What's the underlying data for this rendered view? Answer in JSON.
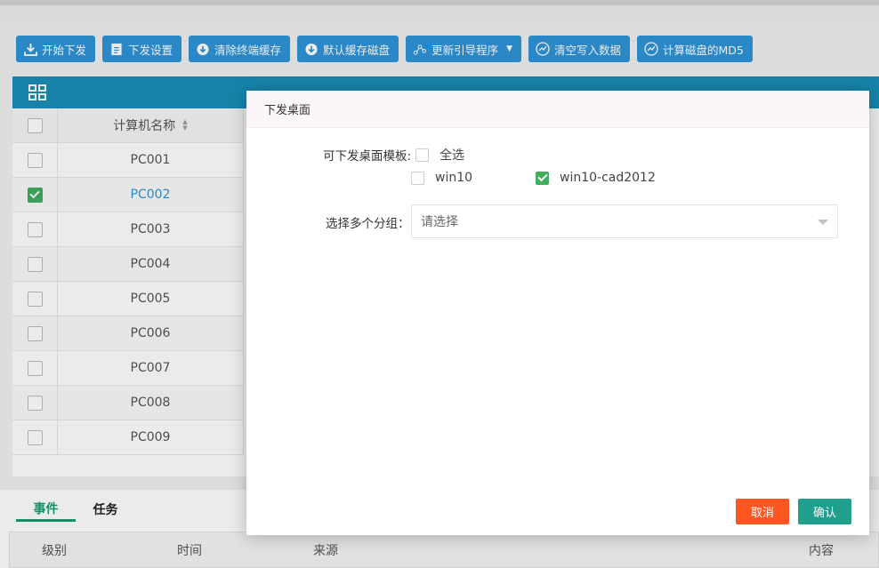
{
  "toolbar": {
    "buttons": [
      {
        "label": "开始下发",
        "icon": "download-icon"
      },
      {
        "label": "下发设置",
        "icon": "file-icon"
      },
      {
        "label": "清除终端缓存",
        "icon": "cloud-download-icon"
      },
      {
        "label": "默认缓存磁盘",
        "icon": "cloud-download-icon"
      },
      {
        "label": "更新引导程序",
        "icon": "network-icon",
        "dropdown": true
      },
      {
        "label": "清空写入数据",
        "icon": "chart-icon"
      },
      {
        "label": "计算磁盘的MD5",
        "icon": "chart-icon"
      }
    ]
  },
  "table": {
    "column_name": "计算机名称",
    "rows": [
      {
        "name": "PC001",
        "checked": false
      },
      {
        "name": "PC002",
        "checked": true
      },
      {
        "name": "PC003",
        "checked": false
      },
      {
        "name": "PC004",
        "checked": false
      },
      {
        "name": "PC005",
        "checked": false
      },
      {
        "name": "PC006",
        "checked": false
      },
      {
        "name": "PC007",
        "checked": false
      },
      {
        "name": "PC008",
        "checked": false
      },
      {
        "name": "PC009",
        "checked": false
      }
    ]
  },
  "bottom": {
    "tabs": [
      {
        "label": "事件",
        "active": true
      },
      {
        "label": "任务",
        "active": false
      }
    ],
    "columns": [
      "级别",
      "时间",
      "来源",
      "内容"
    ]
  },
  "modal": {
    "title": "下发桌面",
    "template_label": "可下发桌面模板:",
    "select_all_label": "全选",
    "options": [
      {
        "label": "win10",
        "checked": false
      },
      {
        "label": "win10-cad2012",
        "checked": true
      }
    ],
    "group_label": "选择多个分组：",
    "group_placeholder": "请选择",
    "cancel_label": "取消",
    "confirm_label": "确认"
  },
  "colors": {
    "toolbar_button": "#2f94d8",
    "panel_header": "#1a8fb8",
    "checked": "#3fae5f",
    "cancel": "#ff5722",
    "confirm": "#1fa08c"
  }
}
